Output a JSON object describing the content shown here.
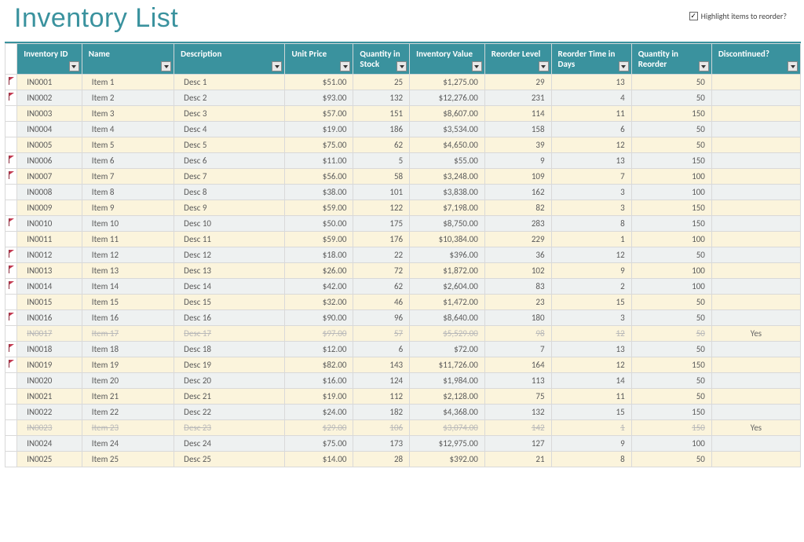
{
  "title": "Inventory List",
  "highlight": {
    "label": "Highlight items to reorder?",
    "checked": true
  },
  "columns": [
    {
      "key": "id",
      "label": "Inventory ID"
    },
    {
      "key": "name",
      "label": "Name"
    },
    {
      "key": "desc",
      "label": "Description"
    },
    {
      "key": "price",
      "label": "Unit Price"
    },
    {
      "key": "qty",
      "label": "Quantity in Stock"
    },
    {
      "key": "val",
      "label": "Inventory Value"
    },
    {
      "key": "reorder",
      "label": "Reorder Level"
    },
    {
      "key": "time",
      "label": "Reorder Time in Days"
    },
    {
      "key": "qtyr",
      "label": "Quantity in Reorder"
    },
    {
      "key": "disc",
      "label": "Discontinued?"
    }
  ],
  "rows": [
    {
      "flag": true,
      "id": "IN0001",
      "name": "Item 1",
      "desc": "Desc 1",
      "price": "$51.00",
      "qty": "25",
      "val": "$1,275.00",
      "reorder": "29",
      "time": "13",
      "qtyr": "50",
      "disc": "",
      "discont": false
    },
    {
      "flag": true,
      "id": "IN0002",
      "name": "Item 2",
      "desc": "Desc 2",
      "price": "$93.00",
      "qty": "132",
      "val": "$12,276.00",
      "reorder": "231",
      "time": "4",
      "qtyr": "50",
      "disc": "",
      "discont": false
    },
    {
      "flag": false,
      "id": "IN0003",
      "name": "Item 3",
      "desc": "Desc 3",
      "price": "$57.00",
      "qty": "151",
      "val": "$8,607.00",
      "reorder": "114",
      "time": "11",
      "qtyr": "150",
      "disc": "",
      "discont": false
    },
    {
      "flag": false,
      "id": "IN0004",
      "name": "Item 4",
      "desc": "Desc 4",
      "price": "$19.00",
      "qty": "186",
      "val": "$3,534.00",
      "reorder": "158",
      "time": "6",
      "qtyr": "50",
      "disc": "",
      "discont": false
    },
    {
      "flag": false,
      "id": "IN0005",
      "name": "Item 5",
      "desc": "Desc 5",
      "price": "$75.00",
      "qty": "62",
      "val": "$4,650.00",
      "reorder": "39",
      "time": "12",
      "qtyr": "50",
      "disc": "",
      "discont": false
    },
    {
      "flag": true,
      "id": "IN0006",
      "name": "Item 6",
      "desc": "Desc 6",
      "price": "$11.00",
      "qty": "5",
      "val": "$55.00",
      "reorder": "9",
      "time": "13",
      "qtyr": "150",
      "disc": "",
      "discont": false
    },
    {
      "flag": true,
      "id": "IN0007",
      "name": "Item 7",
      "desc": "Desc 7",
      "price": "$56.00",
      "qty": "58",
      "val": "$3,248.00",
      "reorder": "109",
      "time": "7",
      "qtyr": "100",
      "disc": "",
      "discont": false
    },
    {
      "flag": false,
      "id": "IN0008",
      "name": "Item 8",
      "desc": "Desc 8",
      "price": "$38.00",
      "qty": "101",
      "val": "$3,838.00",
      "reorder": "162",
      "time": "3",
      "qtyr": "100",
      "disc": "",
      "discont": false
    },
    {
      "flag": false,
      "id": "IN0009",
      "name": "Item 9",
      "desc": "Desc 9",
      "price": "$59.00",
      "qty": "122",
      "val": "$7,198.00",
      "reorder": "82",
      "time": "3",
      "qtyr": "150",
      "disc": "",
      "discont": false
    },
    {
      "flag": true,
      "id": "IN0010",
      "name": "Item 10",
      "desc": "Desc 10",
      "price": "$50.00",
      "qty": "175",
      "val": "$8,750.00",
      "reorder": "283",
      "time": "8",
      "qtyr": "150",
      "disc": "",
      "discont": false
    },
    {
      "flag": false,
      "id": "IN0011",
      "name": "Item 11",
      "desc": "Desc 11",
      "price": "$59.00",
      "qty": "176",
      "val": "$10,384.00",
      "reorder": "229",
      "time": "1",
      "qtyr": "100",
      "disc": "",
      "discont": false
    },
    {
      "flag": true,
      "id": "IN0012",
      "name": "Item 12",
      "desc": "Desc 12",
      "price": "$18.00",
      "qty": "22",
      "val": "$396.00",
      "reorder": "36",
      "time": "12",
      "qtyr": "50",
      "disc": "",
      "discont": false
    },
    {
      "flag": true,
      "id": "IN0013",
      "name": "Item 13",
      "desc": "Desc 13",
      "price": "$26.00",
      "qty": "72",
      "val": "$1,872.00",
      "reorder": "102",
      "time": "9",
      "qtyr": "100",
      "disc": "",
      "discont": false
    },
    {
      "flag": true,
      "id": "IN0014",
      "name": "Item 14",
      "desc": "Desc 14",
      "price": "$42.00",
      "qty": "62",
      "val": "$2,604.00",
      "reorder": "83",
      "time": "2",
      "qtyr": "100",
      "disc": "",
      "discont": false
    },
    {
      "flag": false,
      "id": "IN0015",
      "name": "Item 15",
      "desc": "Desc 15",
      "price": "$32.00",
      "qty": "46",
      "val": "$1,472.00",
      "reorder": "23",
      "time": "15",
      "qtyr": "50",
      "disc": "",
      "discont": false
    },
    {
      "flag": true,
      "id": "IN0016",
      "name": "Item 16",
      "desc": "Desc 16",
      "price": "$90.00",
      "qty": "96",
      "val": "$8,640.00",
      "reorder": "180",
      "time": "3",
      "qtyr": "50",
      "disc": "",
      "discont": false
    },
    {
      "flag": false,
      "id": "IN0017",
      "name": "Item 17",
      "desc": "Desc 17",
      "price": "$97.00",
      "qty": "57",
      "val": "$5,529.00",
      "reorder": "98",
      "time": "12",
      "qtyr": "50",
      "disc": "Yes",
      "discont": true
    },
    {
      "flag": true,
      "id": "IN0018",
      "name": "Item 18",
      "desc": "Desc 18",
      "price": "$12.00",
      "qty": "6",
      "val": "$72.00",
      "reorder": "7",
      "time": "13",
      "qtyr": "50",
      "disc": "",
      "discont": false
    },
    {
      "flag": true,
      "id": "IN0019",
      "name": "Item 19",
      "desc": "Desc 19",
      "price": "$82.00",
      "qty": "143",
      "val": "$11,726.00",
      "reorder": "164",
      "time": "12",
      "qtyr": "150",
      "disc": "",
      "discont": false
    },
    {
      "flag": false,
      "id": "IN0020",
      "name": "Item 20",
      "desc": "Desc 20",
      "price": "$16.00",
      "qty": "124",
      "val": "$1,984.00",
      "reorder": "113",
      "time": "14",
      "qtyr": "50",
      "disc": "",
      "discont": false
    },
    {
      "flag": false,
      "id": "IN0021",
      "name": "Item 21",
      "desc": "Desc 21",
      "price": "$19.00",
      "qty": "112",
      "val": "$2,128.00",
      "reorder": "75",
      "time": "11",
      "qtyr": "50",
      "disc": "",
      "discont": false
    },
    {
      "flag": false,
      "id": "IN0022",
      "name": "Item 22",
      "desc": "Desc 22",
      "price": "$24.00",
      "qty": "182",
      "val": "$4,368.00",
      "reorder": "132",
      "time": "15",
      "qtyr": "150",
      "disc": "",
      "discont": false
    },
    {
      "flag": false,
      "id": "IN0023",
      "name": "Item 23",
      "desc": "Desc 23",
      "price": "$29.00",
      "qty": "106",
      "val": "$3,074.00",
      "reorder": "142",
      "time": "1",
      "qtyr": "150",
      "disc": "Yes",
      "discont": true
    },
    {
      "flag": false,
      "id": "IN0024",
      "name": "Item 24",
      "desc": "Desc 24",
      "price": "$75.00",
      "qty": "173",
      "val": "$12,975.00",
      "reorder": "127",
      "time": "9",
      "qtyr": "100",
      "disc": "",
      "discont": false
    },
    {
      "flag": false,
      "id": "IN0025",
      "name": "Item 25",
      "desc": "Desc 25",
      "price": "$14.00",
      "qty": "28",
      "val": "$392.00",
      "reorder": "21",
      "time": "8",
      "qtyr": "50",
      "disc": "",
      "discont": false
    }
  ]
}
